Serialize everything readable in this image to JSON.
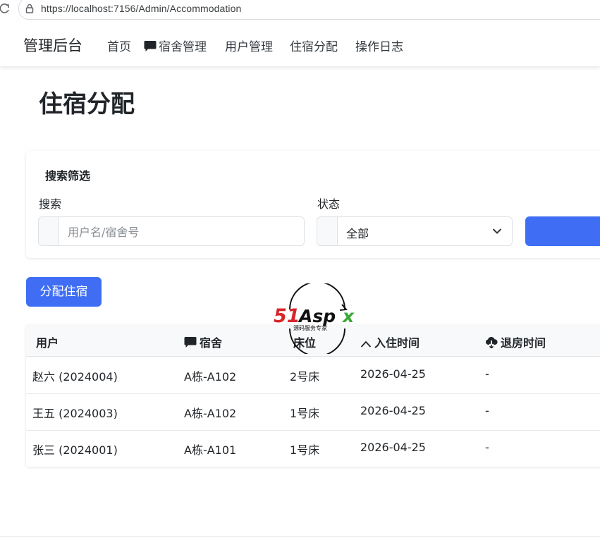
{
  "browser": {
    "url": "https://localhost:7156/Admin/Accommodation"
  },
  "navbar": {
    "brand": "管理后台",
    "links": [
      {
        "label": "首页",
        "icon": ""
      },
      {
        "label": "宿舍管理",
        "icon": "chat-bubble-icon"
      },
      {
        "label": "用户管理",
        "icon": ""
      },
      {
        "label": "住宿分配",
        "icon": ""
      },
      {
        "label": "操作日志",
        "icon": ""
      }
    ]
  },
  "page": {
    "title": "住宿分配"
  },
  "filter": {
    "card_title": "搜索筛选",
    "search_label": "搜索",
    "search_placeholder": "用户名/宿舍号",
    "search_value": "",
    "status_label": "状态",
    "status_value": "全部"
  },
  "actions": {
    "assign_label": "分配住宿"
  },
  "table": {
    "headers": [
      {
        "label": "用户",
        "icon": ""
      },
      {
        "label": "宿舍",
        "icon": "chat-bubble-icon"
      },
      {
        "label": "床位",
        "icon": ""
      },
      {
        "label": "入住时间",
        "icon": "chevron-up-icon"
      },
      {
        "label": "退房时间",
        "icon": "cloud-download-icon"
      }
    ],
    "rows": [
      [
        "赵六 (2024004)",
        "A栋-A102",
        "2号床",
        "2026-04-25",
        "-"
      ],
      [
        "王五 (2024003)",
        "A栋-A102",
        "1号床",
        "2026-04-25",
        "-"
      ],
      [
        "张三 (2024001)",
        "A栋-A101",
        "1号床",
        "2026-04-25",
        "-"
      ]
    ]
  },
  "watermark": {
    "brand": "51Aspx",
    "tagline": "源码服务专家"
  },
  "colors": {
    "primary": "#3f6ef5",
    "watermark_red": "#d7262b",
    "watermark_green": "#39a935"
  }
}
